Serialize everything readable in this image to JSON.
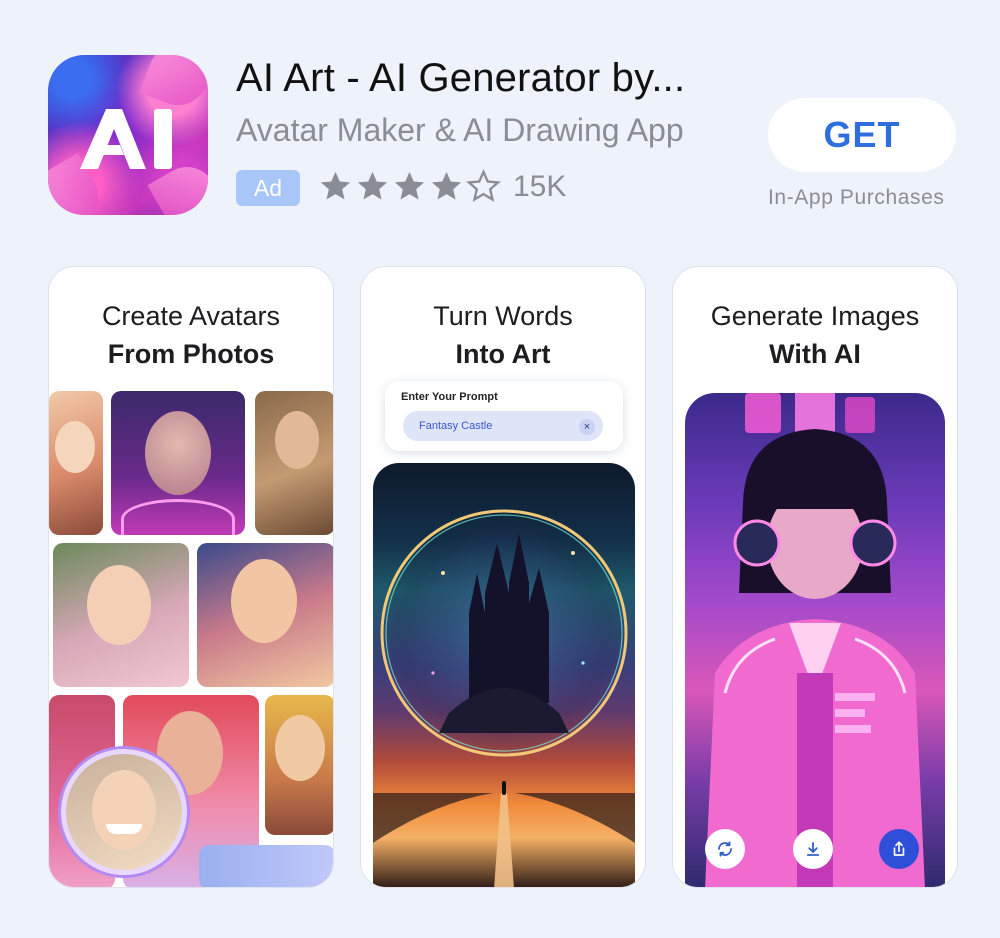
{
  "app": {
    "title": "AI Art - AI Generator by...",
    "subtitle": "Avatar Maker & AI Drawing App",
    "ad_badge": "Ad",
    "rating": 4.5,
    "rating_max": 5,
    "rating_count": "15K",
    "get_label": "GET",
    "iap_label": "In-App Purchases",
    "icon_text": "AI",
    "accent_color": "#2f6fdd"
  },
  "screenshots": [
    {
      "heading_line1": "Create Avatars",
      "heading_line2": "From Photos"
    },
    {
      "heading_line1": "Turn Words",
      "heading_line2": "Into Art",
      "prompt_label": "Enter Your Prompt",
      "prompt_value": "Fantasy Castle",
      "prompt_clear": "×"
    },
    {
      "heading_line1": "Generate Images",
      "heading_line2": "With AI",
      "actions": [
        "refresh-icon",
        "download-icon",
        "share-icon"
      ]
    }
  ]
}
